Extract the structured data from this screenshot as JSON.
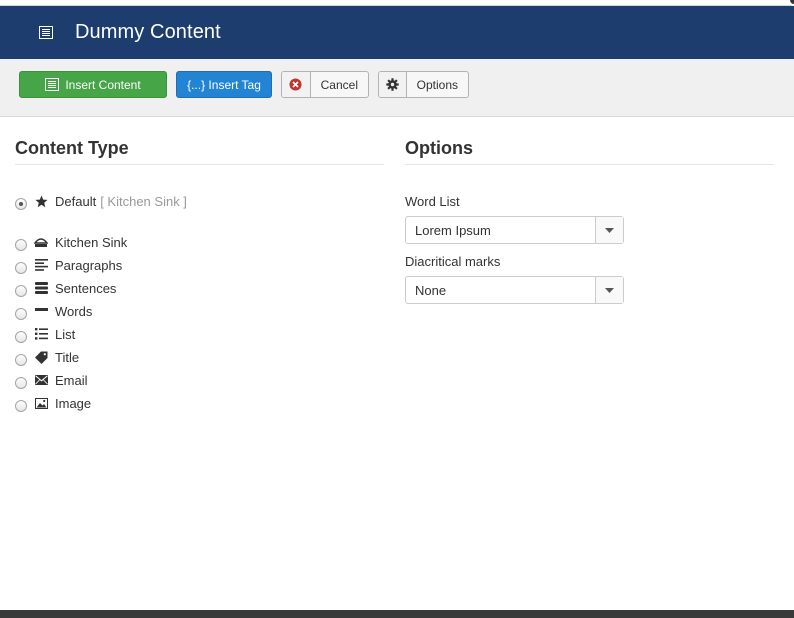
{
  "header": {
    "title": "Dummy Content",
    "icon": "list-icon",
    "background": "#1c3d6e"
  },
  "toolbar": {
    "insert_content_label": "Insert Content",
    "insert_tag_label": "{...} Insert Tag",
    "cancel_label": "Cancel",
    "options_label": "Options",
    "insert_color": "#46a546",
    "tag_color": "#2384d3"
  },
  "content_type": {
    "title": "Content Type",
    "default": {
      "label": "Default",
      "sub": "[ Kitchen Sink ]",
      "icon": "star-icon",
      "selected": true
    },
    "items": [
      {
        "label": "Kitchen Sink",
        "icon": "kitchen-sink-icon",
        "selected": false
      },
      {
        "label": "Paragraphs",
        "icon": "paragraphs-icon",
        "selected": false
      },
      {
        "label": "Sentences",
        "icon": "sentences-icon",
        "selected": false
      },
      {
        "label": "Words",
        "icon": "words-icon",
        "selected": false
      },
      {
        "label": "List",
        "icon": "list-bullets-icon",
        "selected": false
      },
      {
        "label": "Title",
        "icon": "tag-icon",
        "selected": false
      },
      {
        "label": "Email",
        "icon": "envelope-icon",
        "selected": false
      },
      {
        "label": "Image",
        "icon": "image-icon",
        "selected": false
      }
    ]
  },
  "options": {
    "title": "Options",
    "word_list_label": "Word List",
    "word_list_value": "Lorem Ipsum",
    "diacritical_label": "Diacritical marks",
    "diacritical_value": "None"
  }
}
